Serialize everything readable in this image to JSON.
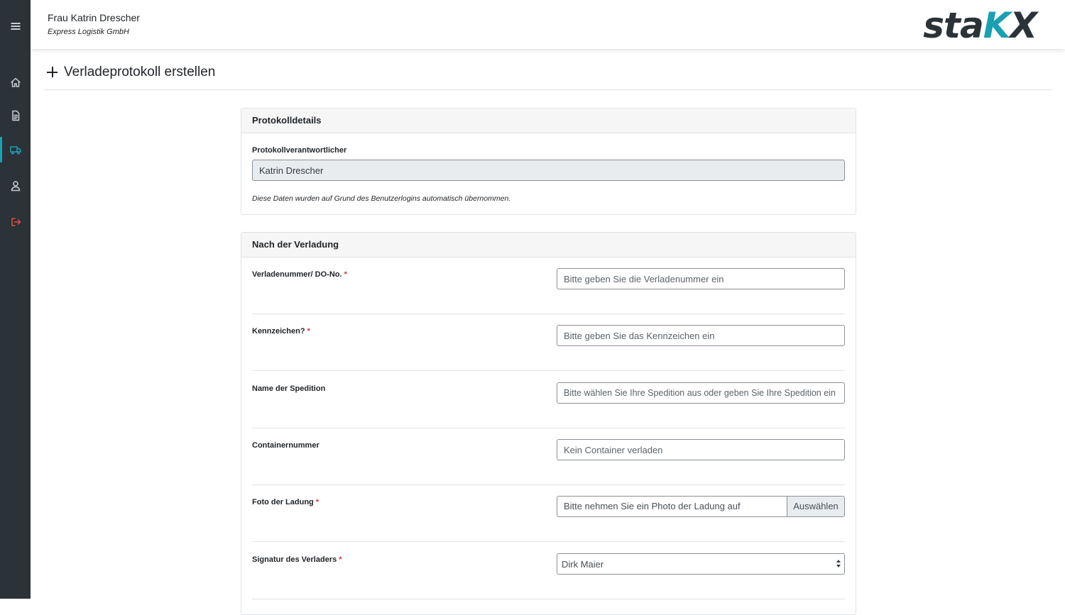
{
  "header": {
    "user_name": "Frau Katrin Drescher",
    "company": "Express Logistik GmbH",
    "logo_parts": [
      "sta",
      "K",
      "X"
    ]
  },
  "colors": {
    "sidebar": "#2b3238",
    "accent": "#1aa0b3",
    "logout": "#e0533f",
    "required": "#dc3545"
  },
  "sidebar": {
    "items": [
      {
        "icon": "menu-icon",
        "active": false
      },
      {
        "icon": "home-icon",
        "active": false
      },
      {
        "icon": "document-icon",
        "active": false
      },
      {
        "icon": "truck-icon",
        "active": true
      },
      {
        "icon": "user-icon",
        "active": false
      },
      {
        "icon": "logout-icon",
        "active": false
      }
    ]
  },
  "page": {
    "title": "Verladeprotokoll erstellen"
  },
  "details": {
    "header": "Protokolldetails",
    "responsible_label": "Protokollverantwortlicher",
    "responsible_value": "Katrin Drescher",
    "help": "Diese Daten wurden auf Grund des Benutzerlogins automatisch übernommen."
  },
  "after": {
    "header": "Nach der Verladung",
    "required_mark": "*",
    "fields": [
      {
        "label": "Verladenummer/ DO-No.",
        "required": true,
        "placeholder": "Bitte geben Sie die Verladenummer ein"
      },
      {
        "label": "Kennzeichen?",
        "required": true,
        "placeholder": "Bitte geben Sie das Kennzeichen ein"
      },
      {
        "label": "Name der Spedition",
        "required": false,
        "placeholder": "Bitte wählen Sie Ihre Spedition aus oder geben Sie Ihre Spedition ein"
      },
      {
        "label": "Containernummer",
        "required": false,
        "placeholder": "Kein Container verladen"
      },
      {
        "label": "Foto der Ladung",
        "required": true,
        "placeholder": "Bitte nehmen Sie ein Photo der Ladung auf",
        "button": "Auswählen"
      },
      {
        "label": "Signatur des Verladers",
        "required": true,
        "value": "Dirk Maier"
      }
    ]
  }
}
